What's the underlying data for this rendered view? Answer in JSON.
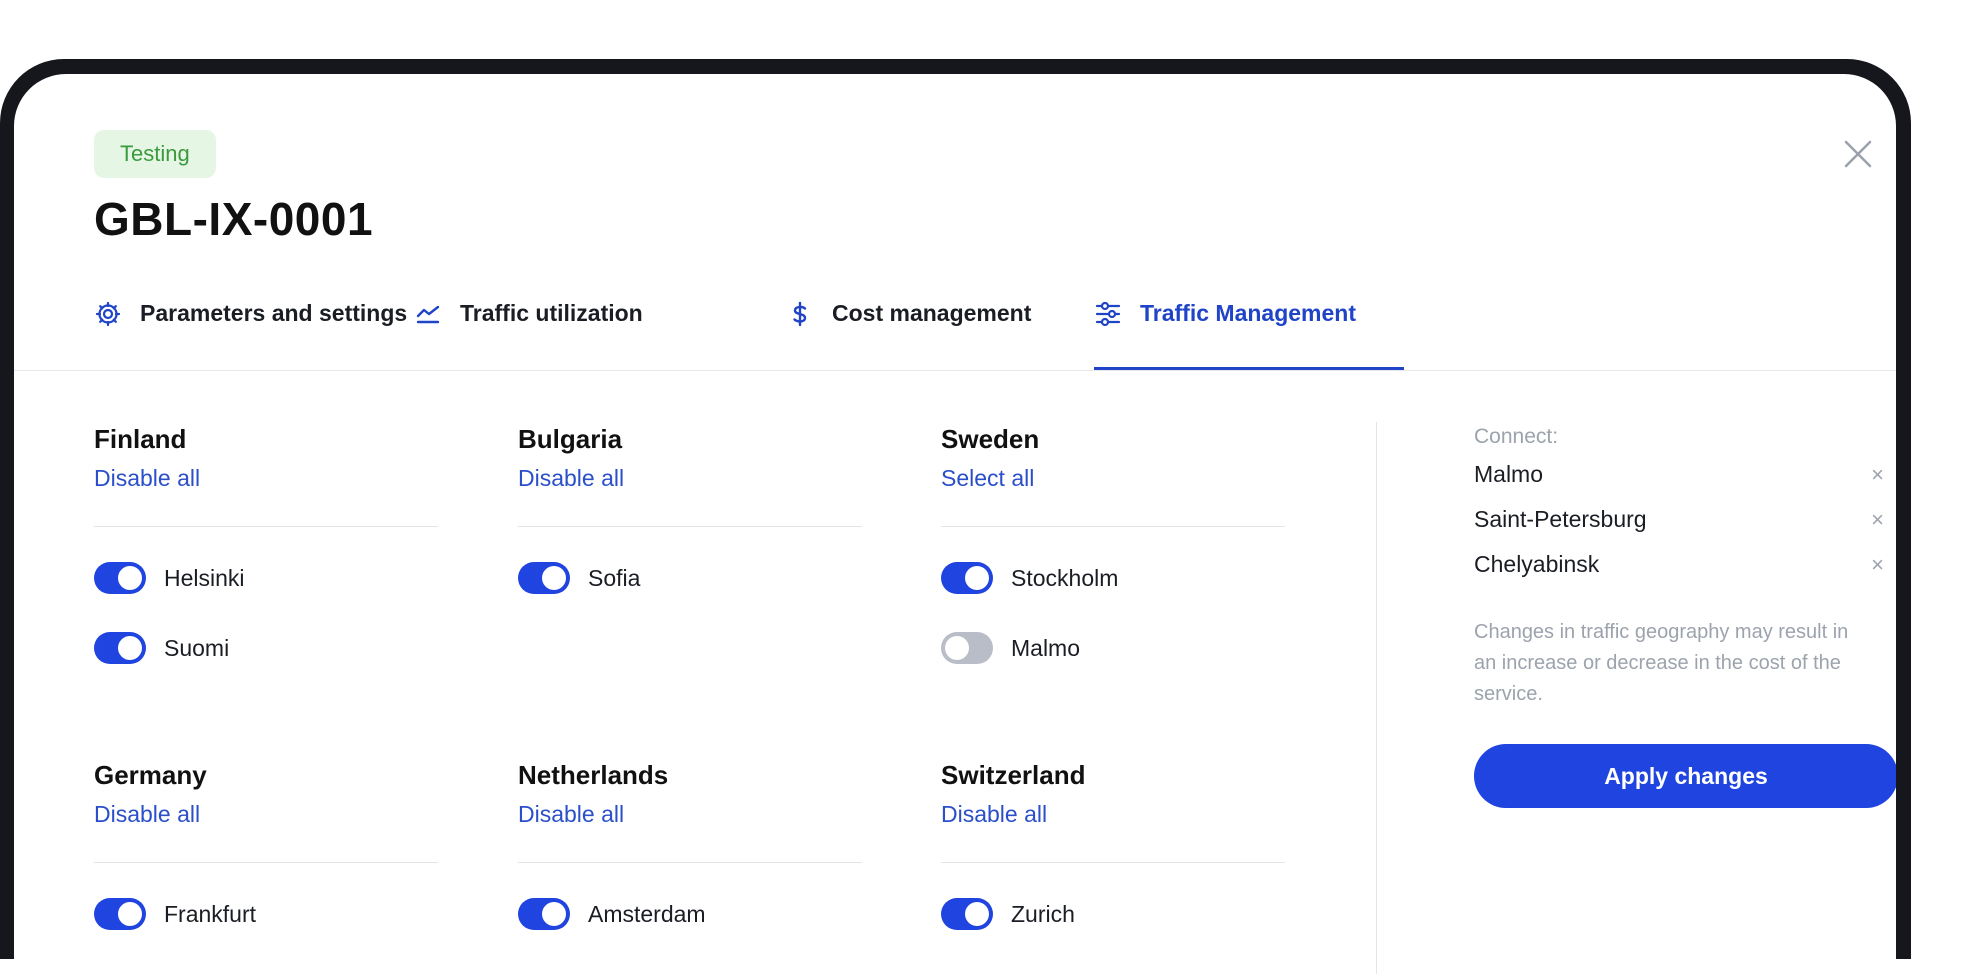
{
  "badge": "Testing",
  "title": "GBL-IX-0001",
  "tabs": [
    {
      "label": "Parameters and settings",
      "icon": "gear-icon"
    },
    {
      "label": "Traffic utilization",
      "icon": "chart-line-icon"
    },
    {
      "label": "Cost management",
      "icon": "dollar-icon"
    },
    {
      "label": "Traffic Management",
      "icon": "sliders-icon",
      "active": true
    }
  ],
  "countries": [
    {
      "name": "Finland",
      "action": "Disable all",
      "cities": [
        {
          "name": "Helsinki",
          "on": true
        },
        {
          "name": "Suomi",
          "on": true
        }
      ]
    },
    {
      "name": "Bulgaria",
      "action": "Disable all",
      "cities": [
        {
          "name": "Sofia",
          "on": true
        }
      ]
    },
    {
      "name": "Sweden",
      "action": "Select all",
      "cities": [
        {
          "name": "Stockholm",
          "on": true
        },
        {
          "name": "Malmo",
          "on": false
        }
      ]
    },
    {
      "name": "Germany",
      "action": "Disable all",
      "cities": [
        {
          "name": "Frankfurt",
          "on": true
        }
      ]
    },
    {
      "name": "Netherlands",
      "action": "Disable all",
      "cities": [
        {
          "name": "Amsterdam",
          "on": true
        }
      ]
    },
    {
      "name": "Switzerland",
      "action": "Disable all",
      "cities": [
        {
          "name": "Zurich",
          "on": true
        }
      ]
    }
  ],
  "sidebar": {
    "heading": "Connect:",
    "items": [
      "Malmo",
      "Saint-Petersburg",
      "Chelyabinsk"
    ],
    "remove_glyph": "×",
    "note": "Changes in traffic geography may result in an increase or decrease in the cost of the service.",
    "apply_label": "Apply changes"
  },
  "colors": {
    "accent": "#1f44e0",
    "link": "#2a4fc9",
    "badge_bg": "#e6f6e4",
    "badge_text": "#3a9a3d"
  }
}
